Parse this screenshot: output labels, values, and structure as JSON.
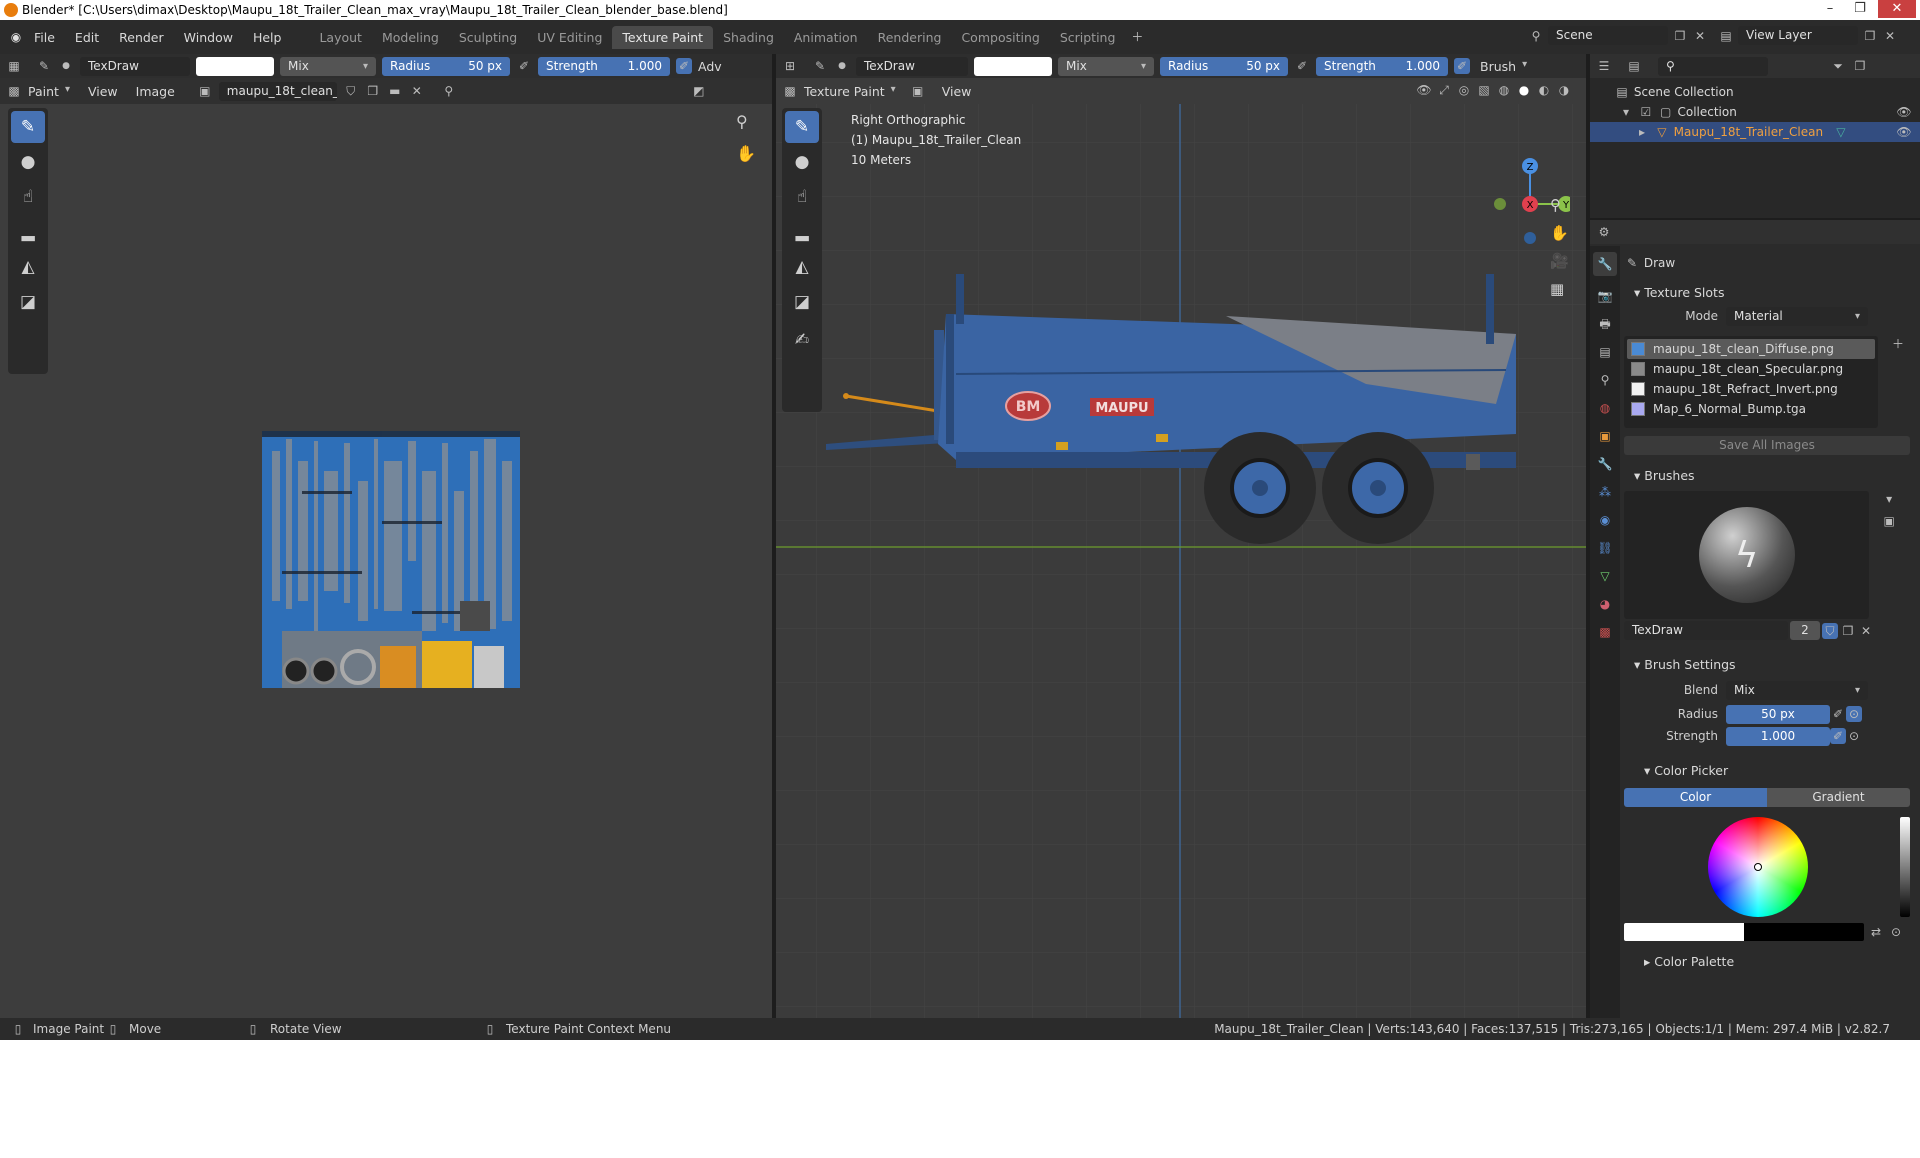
{
  "titlebar": {
    "title": "Blender* [C:\\Users\\dimax\\Desktop\\Maupu_18t_Trailer_Clean_max_vray\\Maupu_18t_Trailer_Clean_blender_base.blend]"
  },
  "menu": {
    "file": "File",
    "edit": "Edit",
    "render": "Render",
    "window": "Window",
    "help": "Help"
  },
  "workspaces": [
    "Layout",
    "Modeling",
    "Sculpting",
    "UV Editing",
    "Texture Paint",
    "Shading",
    "Animation",
    "Rendering",
    "Compositing",
    "Scripting"
  ],
  "scene": {
    "label": "Scene",
    "view_layer": "View Layer"
  },
  "left_editor": {
    "brush_name": "TexDraw",
    "blend": "Mix",
    "radius_label": "Radius",
    "radius_value": "50 px",
    "strength_label": "Strength",
    "strength_value": "1.000",
    "adv_label": "Adv",
    "mode": "Paint",
    "view": "View",
    "image": "Image",
    "image_name": "maupu_18t_clean_..."
  },
  "viewport": {
    "brush_name": "TexDraw",
    "blend": "Mix",
    "radius_label": "Radius",
    "radius_value": "50 px",
    "strength_label": "Strength",
    "strength_value": "1.000",
    "brush_menu": "Brush",
    "mode": "Texture Paint",
    "view": "View",
    "overlay_line1": "Right Orthographic",
    "overlay_line2": "(1) Maupu_18t_Trailer_Clean",
    "overlay_line3": "10 Meters",
    "logo_bm": "BM",
    "logo_maupu": "MAUPU",
    "axes": {
      "z": "Z",
      "y": "Y",
      "x": "X"
    }
  },
  "outliner": {
    "scene_collection": "Scene Collection",
    "collection": "Collection",
    "object": "Maupu_18t_Trailer_Clean"
  },
  "properties": {
    "tool_name": "Draw",
    "texture_slots_header": "Texture Slots",
    "mode_label": "Mode",
    "mode_value": "Material",
    "slots": [
      {
        "name": "maupu_18t_clean_Diffuse.png",
        "color": "#4a8ad4"
      },
      {
        "name": "maupu_18t_clean_Specular.png",
        "color": "#8a8a8a"
      },
      {
        "name": "maupu_18t_Refract_Invert.png",
        "color": "#f2f2f2"
      },
      {
        "name": "Map_6_Normal_Bump.tga",
        "color": "#a9a9f0"
      }
    ],
    "save_all": "Save All Images",
    "brushes_header": "Brushes",
    "brush_name": "TexDraw",
    "brush_users": "2",
    "brush_settings_header": "Brush Settings",
    "blend_label": "Blend",
    "blend_value": "Mix",
    "radius_label": "Radius",
    "radius_value": "50 px",
    "strength_label": "Strength",
    "strength_value": "1.000",
    "color_picker_header": "Color Picker",
    "color_tab": "Color",
    "gradient_tab": "Gradient",
    "color_palette_header": "Color Palette"
  },
  "statusbar": {
    "image_paint": "Image Paint",
    "move": "Move",
    "rotate_view": "Rotate View",
    "context_menu": "Texture Paint Context Menu",
    "stats": "Maupu_18t_Trailer_Clean | Verts:143,640 | Faces:137,515 | Tris:273,165 | Objects:1/1 | Mem: 297.4 MiB | v2.82.7"
  },
  "colors": {
    "accent": "#4772b3",
    "selected_row": "#334d80",
    "trailer_blue": "#3a64a3",
    "x_axis": "#e0404e",
    "y_axis": "#8bc34a",
    "z_axis": "#4a90e2"
  }
}
